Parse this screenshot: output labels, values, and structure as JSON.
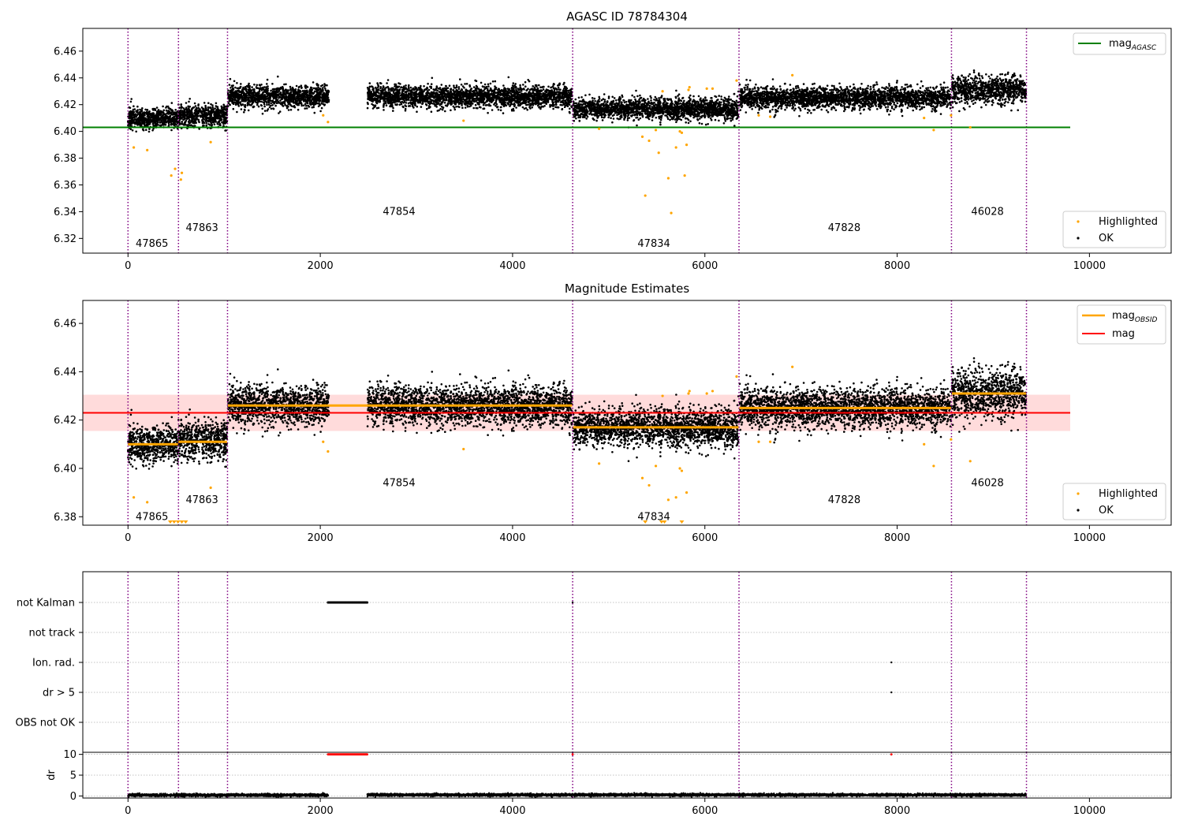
{
  "chart_data": [
    {
      "type": "scatter",
      "title": "AGASC ID 78784304",
      "xlim": [
        -470,
        10850
      ],
      "ylim": [
        6.309,
        6.477
      ],
      "x_ticks": [
        0,
        2000,
        4000,
        6000,
        8000,
        10000
      ],
      "y_ticks": [
        6.32,
        6.34,
        6.36,
        6.38,
        6.4,
        6.42,
        6.44,
        6.46
      ],
      "y_tick_labels": [
        "6.32",
        "6.34",
        "6.36",
        "6.38",
        "6.40",
        "6.42",
        "6.44",
        "6.46"
      ],
      "legends": [
        {
          "placement": "top-right",
          "entries": [
            {
              "label": "mag",
              "sub": "AGASC",
              "color": "#008000",
              "kind": "line"
            }
          ]
        },
        {
          "placement": "bottom-right",
          "entries": [
            {
              "label": "Highlighted",
              "color": "#ffa500",
              "kind": "dot"
            },
            {
              "label": "OK",
              "color": "#000000",
              "kind": "dot"
            }
          ]
        }
      ],
      "hlines": [
        {
          "y": 6.403,
          "x": [
            -470,
            9800
          ],
          "color": "#008000",
          "name": "mag_AGASC"
        }
      ],
      "band": null,
      "obsid_labels": [
        {
          "text": "47865",
          "x": 80,
          "y": 6.316
        },
        {
          "text": "47863",
          "x": 600,
          "y": 6.328
        },
        {
          "text": "47854",
          "x": 2650,
          "y": 6.34
        },
        {
          "text": "47834",
          "x": 5300,
          "y": 6.316
        },
        {
          "text": "47828",
          "x": 7280,
          "y": 6.328
        },
        {
          "text": "46028",
          "x": 8770,
          "y": 6.34
        }
      ],
      "series": [
        {
          "name": "OK",
          "color": "#000000",
          "segments": [
            {
              "x": [
                0,
                520
              ],
              "mean": 6.41,
              "spread": 0.004
            },
            {
              "x": [
                525,
                1030
              ],
              "mean": 6.412,
              "spread": 0.004
            },
            {
              "x": [
                1040,
                2090
              ],
              "mean": 6.426,
              "spread": 0.004
            },
            {
              "x": [
                2490,
                4620
              ],
              "mean": 6.426,
              "spread": 0.004
            },
            {
              "x": [
                4630,
                6350
              ],
              "mean": 6.417,
              "spread": 0.004
            },
            {
              "x": [
                6360,
                8560
              ],
              "mean": 6.425,
              "spread": 0.004
            },
            {
              "x": [
                8570,
                9340
              ],
              "mean": 6.431,
              "spread": 0.005
            }
          ]
        },
        {
          "name": "Highlighted",
          "color": "#ffa500",
          "points": [
            [
              60,
              6.388
            ],
            [
              200,
              6.386
            ],
            [
              450,
              6.367
            ],
            [
              490,
              6.372
            ],
            [
              550,
              6.364
            ],
            [
              560,
              6.369
            ],
            [
              860,
              6.392
            ],
            [
              2030,
              6.412
            ],
            [
              2080,
              6.407
            ],
            [
              3490,
              6.408
            ],
            [
              4900,
              6.402
            ],
            [
              5350,
              6.396
            ],
            [
              5380,
              6.352
            ],
            [
              5420,
              6.393
            ],
            [
              5490,
              6.401
            ],
            [
              5520,
              6.384
            ],
            [
              5560,
              6.43
            ],
            [
              5620,
              6.365
            ],
            [
              5650,
              6.339
            ],
            [
              5700,
              6.388
            ],
            [
              5740,
              6.4
            ],
            [
              5760,
              6.399
            ],
            [
              5790,
              6.367
            ],
            [
              5810,
              6.39
            ],
            [
              5830,
              6.431
            ],
            [
              5840,
              6.433
            ],
            [
              6020,
              6.432
            ],
            [
              6080,
              6.432
            ],
            [
              6330,
              6.438
            ],
            [
              6560,
              6.412
            ],
            [
              6680,
              6.411
            ],
            [
              6910,
              6.442
            ],
            [
              8280,
              6.41
            ],
            [
              8380,
              6.401
            ],
            [
              8560,
              6.412
            ],
            [
              8760,
              6.403
            ]
          ]
        }
      ]
    },
    {
      "type": "scatter",
      "title": "Magnitude Estimates",
      "xlim": [
        -470,
        10850
      ],
      "ylim": [
        6.3765,
        6.4695
      ],
      "x_ticks": [
        0,
        2000,
        4000,
        6000,
        8000,
        10000
      ],
      "y_ticks": [
        6.38,
        6.4,
        6.42,
        6.44,
        6.46
      ],
      "y_tick_labels": [
        "6.38",
        "6.40",
        "6.42",
        "6.44",
        "6.46"
      ],
      "legends": [
        {
          "placement": "top-right",
          "entries": [
            {
              "label": "mag",
              "sub": "OBSID",
              "color": "#ffa500",
              "kind": "line"
            },
            {
              "label": "mag",
              "sub": "",
              "color": "#ff0000",
              "kind": "line"
            }
          ]
        },
        {
          "placement": "bottom-right",
          "entries": [
            {
              "label": "Highlighted",
              "color": "#ffa500",
              "kind": "dot"
            },
            {
              "label": "OK",
              "color": "#000000",
              "kind": "dot"
            }
          ]
        }
      ],
      "hlines": [
        {
          "y": 6.423,
          "x": [
            -470,
            9800
          ],
          "color": "#ff0000",
          "name": "mag"
        }
      ],
      "band": {
        "y": [
          6.4155,
          6.4305
        ],
        "x": [
          -470,
          9800
        ],
        "color": "#ffcccc"
      },
      "obsid_mag": [
        {
          "x": [
            0,
            520
          ],
          "y": 6.41
        },
        {
          "x": [
            525,
            1030
          ],
          "y": 6.411
        },
        {
          "x": [
            1040,
            4620
          ],
          "y": 6.426
        },
        {
          "x": [
            4630,
            6350
          ],
          "y": 6.417
        },
        {
          "x": [
            6360,
            8560
          ],
          "y": 6.425
        },
        {
          "x": [
            8570,
            9340
          ],
          "y": 6.431
        }
      ],
      "obsid_labels": [
        {
          "text": "47865",
          "x": 80,
          "y": 6.38
        },
        {
          "text": "47863",
          "x": 600,
          "y": 6.387
        },
        {
          "text": "47854",
          "x": 2650,
          "y": 6.394
        },
        {
          "text": "47834",
          "x": 5300,
          "y": 6.38
        },
        {
          "text": "47828",
          "x": 7280,
          "y": 6.387
        },
        {
          "text": "46028",
          "x": 8770,
          "y": 6.394
        }
      ],
      "clipped_markers": [
        440,
        480,
        520,
        560,
        600,
        5380,
        5550,
        5580,
        5760
      ],
      "series": [
        {
          "name": "OK",
          "color": "#000000",
          "segments": [
            {
              "x": [
                0,
                520
              ],
              "mean": 6.41,
              "spread": 0.004
            },
            {
              "x": [
                525,
                1030
              ],
              "mean": 6.412,
              "spread": 0.004
            },
            {
              "x": [
                1040,
                2090
              ],
              "mean": 6.426,
              "spread": 0.004
            },
            {
              "x": [
                2490,
                4620
              ],
              "mean": 6.426,
              "spread": 0.004
            },
            {
              "x": [
                4630,
                6350
              ],
              "mean": 6.417,
              "spread": 0.004
            },
            {
              "x": [
                6360,
                8560
              ],
              "mean": 6.425,
              "spread": 0.004
            },
            {
              "x": [
                8570,
                9340
              ],
              "mean": 6.431,
              "spread": 0.005
            }
          ]
        },
        {
          "name": "Highlighted",
          "color": "#ffa500",
          "points": [
            [
              60,
              6.388
            ],
            [
              200,
              6.386
            ],
            [
              860,
              6.392
            ],
            [
              2030,
              6.411
            ],
            [
              2080,
              6.407
            ],
            [
              3490,
              6.408
            ],
            [
              4900,
              6.402
            ],
            [
              5350,
              6.396
            ],
            [
              5420,
              6.393
            ],
            [
              5490,
              6.401
            ],
            [
              5560,
              6.43
            ],
            [
              5620,
              6.387
            ],
            [
              5700,
              6.388
            ],
            [
              5740,
              6.4
            ],
            [
              5760,
              6.399
            ],
            [
              5810,
              6.39
            ],
            [
              5830,
              6.431
            ],
            [
              5840,
              6.432
            ],
            [
              6020,
              6.431
            ],
            [
              6080,
              6.432
            ],
            [
              6330,
              6.438
            ],
            [
              6560,
              6.411
            ],
            [
              6680,
              6.411
            ],
            [
              6910,
              6.442
            ],
            [
              8280,
              6.41
            ],
            [
              8380,
              6.401
            ],
            [
              8560,
              6.412
            ],
            [
              8760,
              6.403
            ]
          ]
        }
      ]
    },
    {
      "type": "scatter",
      "title": "",
      "xlim": [
        -470,
        10850
      ],
      "categories": [
        "not Kalman",
        "not track",
        "Ion. rad.",
        "dr > 5",
        "OBS not OK"
      ],
      "flags": [
        {
          "category": "not Kalman",
          "x": [
            2080,
            2490
          ],
          "color": "#000000"
        },
        {
          "category": "not Kalman",
          "x": [
            4625,
            4625
          ],
          "color": "#000000"
        },
        {
          "category": "Ion. rad.",
          "x": [
            7940,
            7940
          ],
          "color": "#000000"
        },
        {
          "category": "dr > 5",
          "x": [
            7940,
            7940
          ],
          "color": "#000000"
        }
      ]
    },
    {
      "type": "scatter",
      "title": "",
      "ylabel": "dr",
      "xlim": [
        -470,
        10850
      ],
      "ylim": [
        -0.5,
        10.5
      ],
      "x_ticks": [
        0,
        2000,
        4000,
        6000,
        8000,
        10000
      ],
      "x_tick_labels": [
        "0",
        "2000",
        "4000",
        "6000",
        "8000",
        "10000"
      ],
      "y_ticks": [
        0,
        5,
        10
      ],
      "y_tick_labels": [
        "0",
        "5",
        "10"
      ],
      "series": [
        {
          "name": "dr",
          "color": "#000000",
          "segments": [
            {
              "x": [
                0,
                2080
              ],
              "mean": 0.2,
              "spread": 0.15
            },
            {
              "x": [
                2490,
                9340
              ],
              "mean": 0.25,
              "spread": 0.15
            }
          ]
        },
        {
          "name": "dr-capped",
          "color": "#ff0000",
          "segments": [
            {
              "x": [
                2080,
                2490
              ],
              "y": 10
            }
          ],
          "points": [
            [
              4625,
              10
            ],
            [
              7940,
              10
            ]
          ]
        }
      ]
    }
  ],
  "vlines": {
    "x": [
      0,
      525,
      1035,
      4625,
      6355,
      8565,
      9345
    ],
    "color": "#800080"
  }
}
